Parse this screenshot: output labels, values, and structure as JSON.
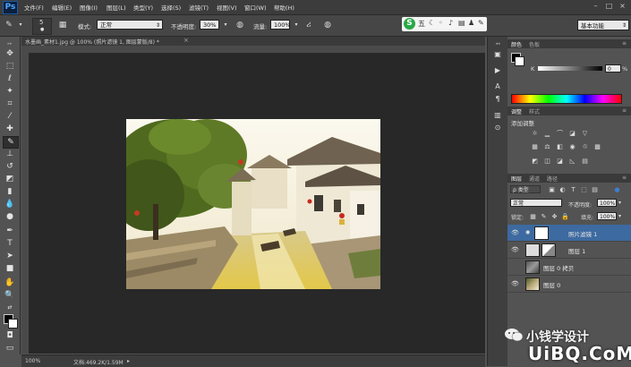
{
  "app": {
    "logo": "Ps"
  },
  "menu": [
    "文件(F)",
    "编辑(E)",
    "图像(I)",
    "图层(L)",
    "类型(Y)",
    "选择(S)",
    "滤镜(T)",
    "视图(V)",
    "窗口(W)",
    "帮助(H)"
  ],
  "window_controls": [
    "–",
    "□",
    "×"
  ],
  "options": {
    "brush_size": "5",
    "mode_label": "模式:",
    "mode_value": "正常",
    "opacity_label": "不透明度:",
    "opacity_value": "30%",
    "flow_label": "流量:",
    "flow_value": "100%"
  },
  "ime": {
    "logo": "S",
    "label": "五"
  },
  "workspace": "基本功能",
  "document": {
    "tab": "水墨画_素材1.jpg @ 100% (照片滤镜 1, 图层蒙版/8) *",
    "zoom": "100%",
    "doc_info": "文档:469.2K/1.59M"
  },
  "color_panel": {
    "tabs": [
      "颜色",
      "色板"
    ],
    "channel": "K",
    "value": "0",
    "unit": "%"
  },
  "adjustments_panel": {
    "tabs": [
      "调整",
      "样式"
    ],
    "title": "添加调整"
  },
  "layers_panel": {
    "tabs": [
      "图层",
      "通道",
      "路径"
    ],
    "filter_label": "ρ 类型",
    "blend_mode": "正常",
    "opacity_label": "不透明度:",
    "opacity_value": "100%",
    "lock_label": "锁定:",
    "fill_label": "填充:",
    "fill_value": "100%",
    "layers": [
      {
        "name": "照片滤镜 1",
        "visible": true,
        "selected": true
      },
      {
        "name": "图层 1",
        "visible": true,
        "selected": false
      },
      {
        "name": "图层 0 拷贝",
        "visible": false,
        "selected": false
      },
      {
        "name": "图层 0",
        "visible": true,
        "selected": false
      }
    ]
  },
  "watermark": {
    "line1": "小钱学设计",
    "line2": "UiBQ.CoM"
  },
  "colors": {
    "accent": "#3d6aa0",
    "canvas_bg": "#282828",
    "panel_bg": "#535353"
  }
}
